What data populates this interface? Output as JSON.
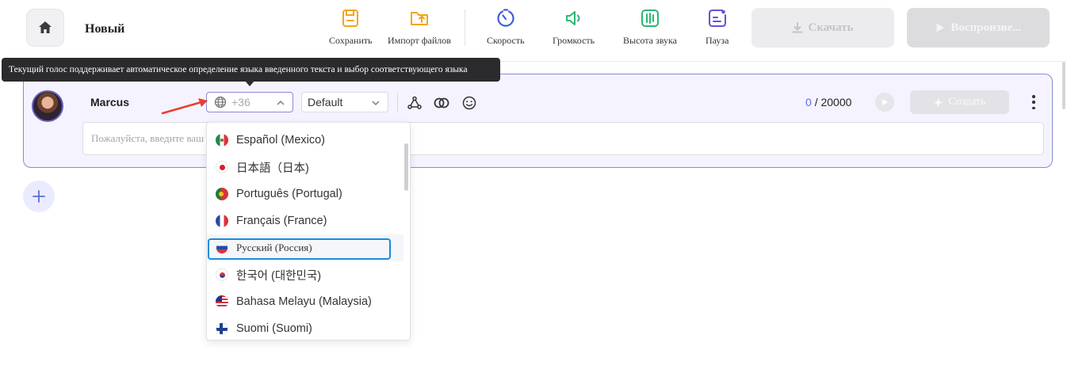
{
  "header": {
    "project_title": "Новый",
    "tools": [
      {
        "label": "Сохранить",
        "icon": "save-icon"
      },
      {
        "label": "Импорт файлов",
        "icon": "folder-import-icon"
      },
      {
        "label": "Скорость",
        "icon": "speed-dial-icon"
      },
      {
        "label": "Громкость",
        "icon": "volume-icon"
      },
      {
        "label": "Высота звука",
        "icon": "equalizer-icon"
      },
      {
        "label": "Пауза",
        "icon": "pause-insert-icon"
      }
    ],
    "download_label": "Скачать",
    "play_label": "Воспроизве..."
  },
  "tooltip": {
    "text": "Текущий голос поддерживает автоматическое определение языка введенного текста и выбор соответствующего языка"
  },
  "voice_card": {
    "speaker_name": "Marcus",
    "language_count": "+36",
    "style_value": "Default",
    "char_current": "0",
    "char_separator": "/",
    "char_max": "20000",
    "create_label": "Создать",
    "text_placeholder": "Пожалуйста, введите ваш"
  },
  "language_dropdown": {
    "items": [
      {
        "label": "Español (Mexico)",
        "flag": "mexico-flag-icon"
      },
      {
        "label": "日本語（日本)",
        "flag": "japan-flag-icon"
      },
      {
        "label": "Português (Portugal)",
        "flag": "portugal-flag-icon"
      },
      {
        "label": "Français (France)",
        "flag": "france-flag-icon"
      },
      {
        "label": "Русский (Россия)",
        "flag": "russia-flag-icon"
      },
      {
        "label": "한국어 (대한민국)",
        "flag": "korea-flag-icon"
      },
      {
        "label": "Bahasa Melayu (Malaysia)",
        "flag": "malaysia-flag-icon"
      },
      {
        "label": "Suomi (Suomi)",
        "flag": "finland-flag-icon"
      }
    ],
    "highlighted_index": 4
  },
  "colors": {
    "accent": "#5b6fd6",
    "card_border": "#8a8ad6",
    "card_bg": "#f4f3ff",
    "focus_ring": "#1a8cdc",
    "annotation_arrow": "#e8402f"
  }
}
